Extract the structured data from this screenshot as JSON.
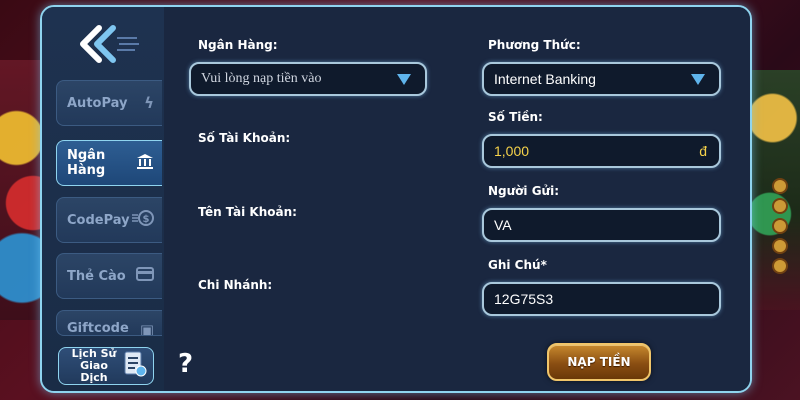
{
  "sidebar": {
    "items": [
      {
        "label": "AutoPay",
        "icon": "lightning-icon"
      },
      {
        "label": "Ngân Hàng",
        "icon": "bank-icon"
      },
      {
        "label": "CodePay",
        "icon": "coin-icon"
      },
      {
        "label": "Thẻ Cào",
        "icon": "card-icon"
      },
      {
        "label": "Giftcode",
        "icon": "gift-icon"
      }
    ],
    "history_line1": "Lịch Sử",
    "history_line2": "Giao Dịch"
  },
  "form": {
    "bank_label": "Ngân Hàng:",
    "bank_placeholder": "Vui lòng nạp tiền vào",
    "account_number_label": "Số Tài Khoản:",
    "account_name_label": "Tên Tài Khoản:",
    "branch_label": "Chi Nhánh:",
    "method_label": "Phương Thức:",
    "method_value": "Internet Banking",
    "amount_label": "Số Tiền:",
    "amount_value": "1,000",
    "amount_unit": "đ",
    "sender_label": "Người Gửi:",
    "sender_value": "VA",
    "note_label": "Ghi Chú*",
    "note_value": "12G75S3"
  },
  "help_symbol": "?",
  "submit_label": "NẠP TIỀN"
}
